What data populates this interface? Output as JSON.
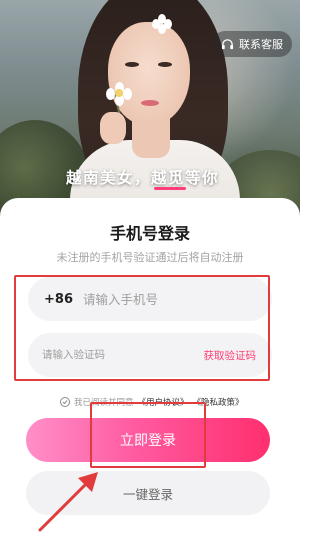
{
  "header": {
    "service_label": "联系客服",
    "slogan": "越南美女，越觅等你",
    "icons": [
      "headset-icon"
    ]
  },
  "login": {
    "title": "手机号登录",
    "subtitle": "未注册的手机号验证通过后将自动注册",
    "country_code": "+86",
    "phone_placeholder": "请输入手机号",
    "code_placeholder": "请输入验证码",
    "get_code_label": "获取验证码",
    "agreement_prefix": "我已阅读并同意",
    "user_agreement": "《用户协议》",
    "privacy_policy": "《隐私政策》",
    "login_button": "立即登录",
    "one_click_button": "一键登录"
  },
  "colors": {
    "accent": "#ff2f6e",
    "annotation": "#e23b3b"
  }
}
